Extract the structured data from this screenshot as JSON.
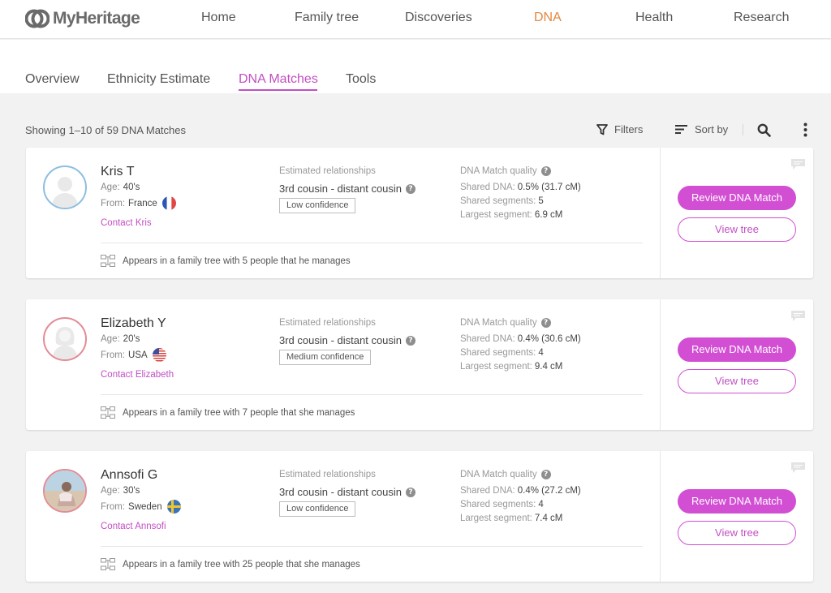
{
  "brand": {
    "name": "MyHeritage"
  },
  "nav": [
    {
      "label": "Home"
    },
    {
      "label": "Family tree"
    },
    {
      "label": "Discoveries"
    },
    {
      "label": "DNA",
      "active": true
    },
    {
      "label": "Health"
    },
    {
      "label": "Research"
    }
  ],
  "tabs": [
    {
      "label": "Overview"
    },
    {
      "label": "Ethnicity Estimate"
    },
    {
      "label": "DNA Matches",
      "active": true
    },
    {
      "label": "Tools"
    }
  ],
  "toolbar": {
    "showing": "Showing 1–10 of 59 DNA Matches",
    "filters": "Filters",
    "sort": "Sort by"
  },
  "labels": {
    "age": "Age:",
    "from": "From:",
    "estimated": "Estimated relationships",
    "quality": "DNA Match quality",
    "shared_dna": "Shared DNA:",
    "shared_segments": "Shared segments:",
    "largest_segment": "Largest segment:",
    "review": "Review DNA Match",
    "view_tree": "View tree"
  },
  "colors": {
    "accent": "#c24fc3",
    "button": "#d24fd3",
    "nav_active": "#e3873f"
  },
  "matches": [
    {
      "name": "Kris T",
      "age": "40's",
      "country": "France",
      "flag": "france-flag",
      "contact": "Contact Kris",
      "relationship": "3rd cousin - distant cousin",
      "confidence": "Low confidence",
      "shared_dna": "0.5% (31.7 cM)",
      "shared_segments": "5",
      "largest_segment": "6.9 cM",
      "tree": "Appears in a family tree with 5 people that he manages"
    },
    {
      "name": "Elizabeth Y",
      "age": "20's",
      "country": "USA",
      "flag": "usa-flag",
      "contact": "Contact Elizabeth",
      "relationship": "3rd cousin - distant cousin",
      "confidence": "Medium confidence",
      "shared_dna": "0.4% (30.6 cM)",
      "shared_segments": "4",
      "largest_segment": "9.4 cM",
      "tree": "Appears in a family tree with 7 people that she manages"
    },
    {
      "name": "Annsofi G",
      "age": "30's",
      "country": "Sweden",
      "flag": "sweden-flag",
      "contact": "Contact Annsofi",
      "relationship": "3rd cousin - distant cousin",
      "confidence": "Low confidence",
      "shared_dna": "0.4% (27.2 cM)",
      "shared_segments": "4",
      "largest_segment": "7.4 cM",
      "tree": "Appears in a family tree with 25 people that she manages"
    }
  ]
}
